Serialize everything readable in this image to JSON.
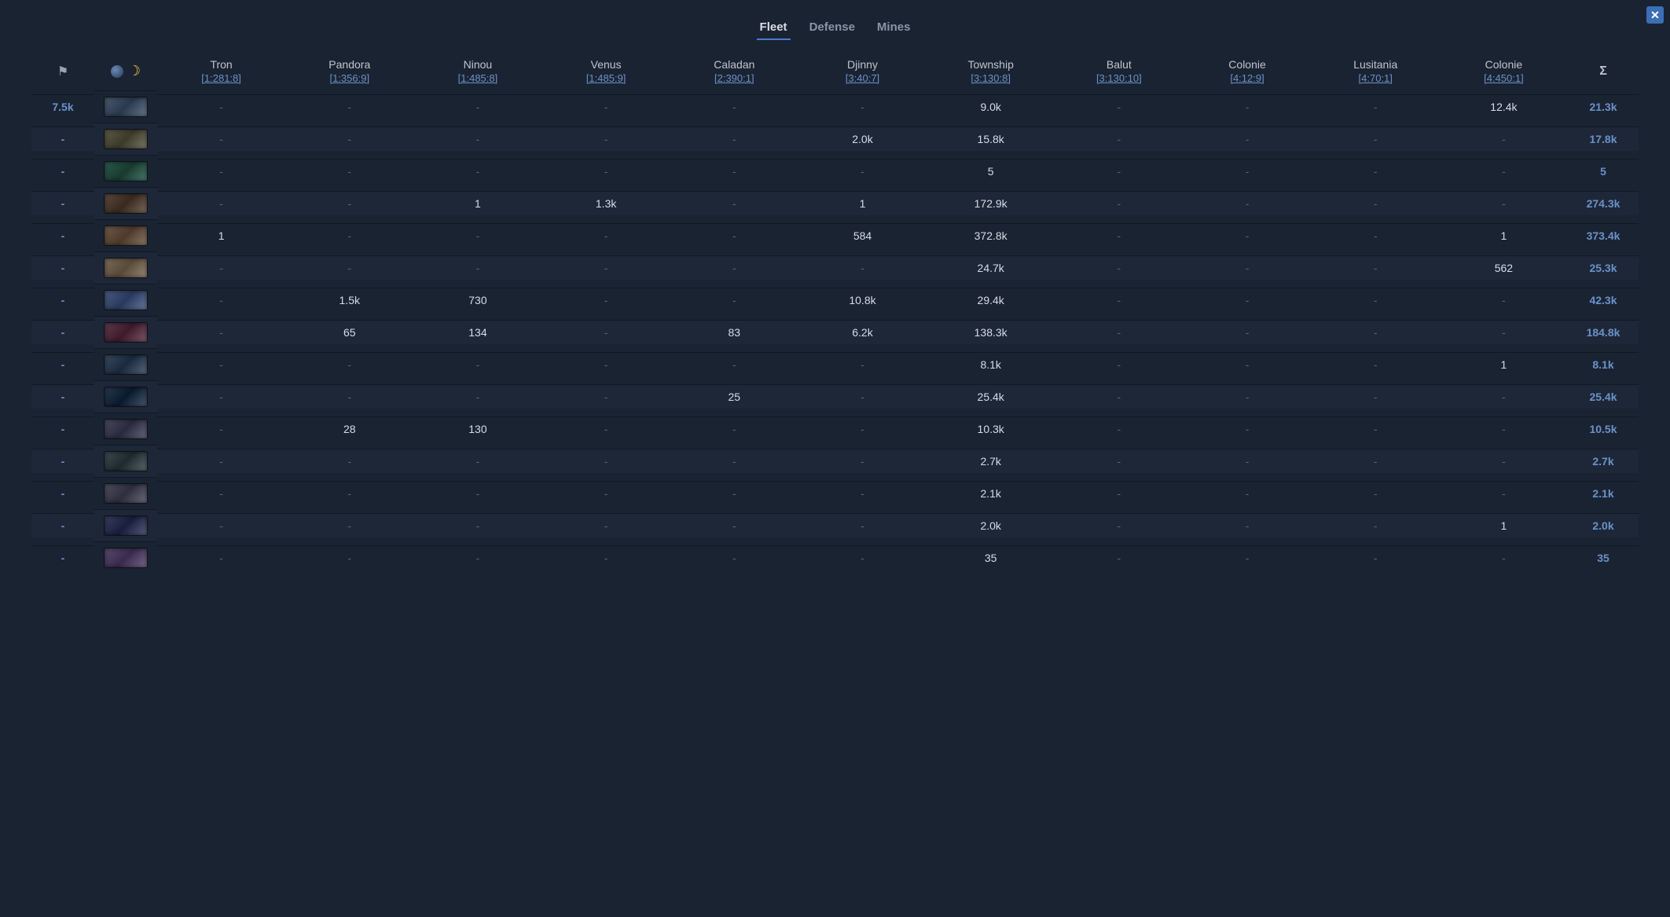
{
  "tabs": [
    {
      "label": "Fleet",
      "active": true
    },
    {
      "label": "Defense",
      "active": false
    },
    {
      "label": "Mines",
      "active": false
    }
  ],
  "sigma_label": "Σ",
  "planets": [
    {
      "name": "Tron",
      "coord": "[1:281:8]"
    },
    {
      "name": "Pandora",
      "coord": "[1:356:9]"
    },
    {
      "name": "Ninou",
      "coord": "[1:485:8]"
    },
    {
      "name": "Venus",
      "coord": "[1:485:9]"
    },
    {
      "name": "Caladan",
      "coord": "[2:390:1]"
    },
    {
      "name": "Djinny",
      "coord": "[3:40:7]"
    },
    {
      "name": "Township",
      "coord": "[3:130:8]"
    },
    {
      "name": "Balut",
      "coord": "[3:130:10]"
    },
    {
      "name": "Colonie",
      "coord": "[4:12:9]"
    },
    {
      "name": "Lusitania",
      "coord": "[4:70:1]"
    },
    {
      "name": "Colonie",
      "coord": "[4:450:1]"
    }
  ],
  "rows": [
    {
      "left": "7.5k",
      "cells": [
        "-",
        "-",
        "-",
        "-",
        "-",
        "-",
        "9.0k",
        "-",
        "-",
        "-",
        "12.4k"
      ],
      "sum": "21.3k"
    },
    {
      "left": "-",
      "cells": [
        "-",
        "-",
        "-",
        "-",
        "-",
        "2.0k",
        "15.8k",
        "-",
        "-",
        "-",
        "-"
      ],
      "sum": "17.8k"
    },
    {
      "left": "-",
      "cells": [
        "-",
        "-",
        "-",
        "-",
        "-",
        "-",
        "5",
        "-",
        "-",
        "-",
        "-"
      ],
      "sum": "5"
    },
    {
      "left": "-",
      "cells": [
        "-",
        "-",
        "1",
        "1.3k",
        "-",
        "1",
        "172.9k",
        "-",
        "-",
        "-",
        "-"
      ],
      "sum": "274.3k"
    },
    {
      "left": "-",
      "cells": [
        "1",
        "-",
        "-",
        "-",
        "-",
        "584",
        "372.8k",
        "-",
        "-",
        "-",
        "1"
      ],
      "sum": "373.4k"
    },
    {
      "left": "-",
      "cells": [
        "-",
        "-",
        "-",
        "-",
        "-",
        "-",
        "24.7k",
        "-",
        "-",
        "-",
        "562"
      ],
      "sum": "25.3k"
    },
    {
      "left": "-",
      "cells": [
        "-",
        "1.5k",
        "730",
        "-",
        "-",
        "10.8k",
        "29.4k",
        "-",
        "-",
        "-",
        "-"
      ],
      "sum": "42.3k"
    },
    {
      "left": "-",
      "cells": [
        "-",
        "65",
        "134",
        "-",
        "83",
        "6.2k",
        "138.3k",
        "-",
        "-",
        "-",
        "-"
      ],
      "sum": "184.8k"
    },
    {
      "left": "-",
      "cells": [
        "-",
        "-",
        "-",
        "-",
        "-",
        "-",
        "8.1k",
        "-",
        "-",
        "-",
        "1"
      ],
      "sum": "8.1k"
    },
    {
      "left": "-",
      "cells": [
        "-",
        "-",
        "-",
        "-",
        "25",
        "-",
        "25.4k",
        "-",
        "-",
        "-",
        "-"
      ],
      "sum": "25.4k"
    },
    {
      "left": "-",
      "cells": [
        "-",
        "28",
        "130",
        "-",
        "-",
        "-",
        "10.3k",
        "-",
        "-",
        "-",
        "-"
      ],
      "sum": "10.5k"
    },
    {
      "left": "-",
      "cells": [
        "-",
        "-",
        "-",
        "-",
        "-",
        "-",
        "2.7k",
        "-",
        "-",
        "-",
        "-"
      ],
      "sum": "2.7k"
    },
    {
      "left": "-",
      "cells": [
        "-",
        "-",
        "-",
        "-",
        "-",
        "-",
        "2.1k",
        "-",
        "-",
        "-",
        "-"
      ],
      "sum": "2.1k"
    },
    {
      "left": "-",
      "cells": [
        "-",
        "-",
        "-",
        "-",
        "-",
        "-",
        "2.0k",
        "-",
        "-",
        "-",
        "1"
      ],
      "sum": "2.0k"
    },
    {
      "left": "-",
      "cells": [
        "-",
        "-",
        "-",
        "-",
        "-",
        "-",
        "35",
        "-",
        "-",
        "-",
        "-"
      ],
      "sum": "35"
    }
  ]
}
